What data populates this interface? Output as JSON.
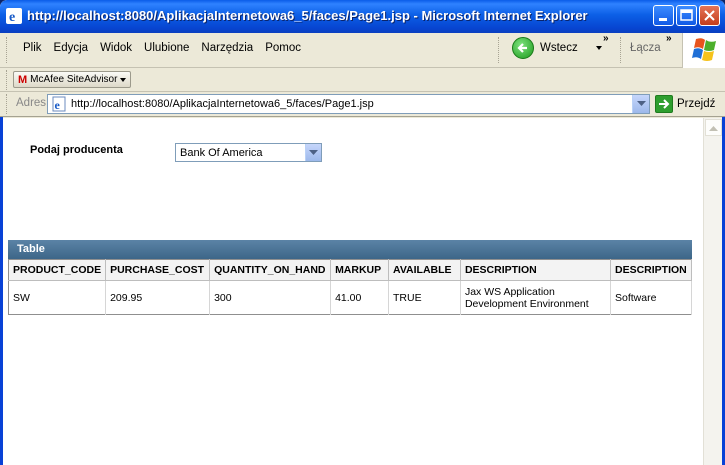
{
  "window": {
    "title": "http://localhost:8080/AplikacjaInternetowa6_5/faces/Page1.jsp - Microsoft Internet Explorer"
  },
  "menu": {
    "items": [
      "Plik",
      "Edycja",
      "Widok",
      "Ulubione",
      "Narzędzia",
      "Pomoc"
    ]
  },
  "toolbar": {
    "back_label": "Wstecz",
    "links_label": "Łącza",
    "chevron": "»"
  },
  "mcafee": {
    "label": "McAfee SiteAdvisor"
  },
  "address": {
    "label": "Adres",
    "url": "http://localhost:8080/AplikacjaInternetowa6_5/faces/Page1.jsp",
    "go_label": "Przejdź"
  },
  "form": {
    "label": "Podaj producenta",
    "selected": "Bank Of America"
  },
  "table": {
    "caption": "Table",
    "headers": [
      "PRODUCT_CODE",
      "PURCHASE_COST",
      "QUANTITY_ON_HAND",
      "MARKUP",
      "AVAILABLE",
      "DESCRIPTION",
      "DESCRIPTION"
    ],
    "rows": [
      [
        "SW",
        "209.95",
        "300",
        "41.00",
        "TRUE",
        "Jax WS Application Development Environment",
        "Software"
      ]
    ]
  },
  "colors": {
    "titlebar": "#0a5ce8",
    "table_caption": "#4a7396"
  }
}
